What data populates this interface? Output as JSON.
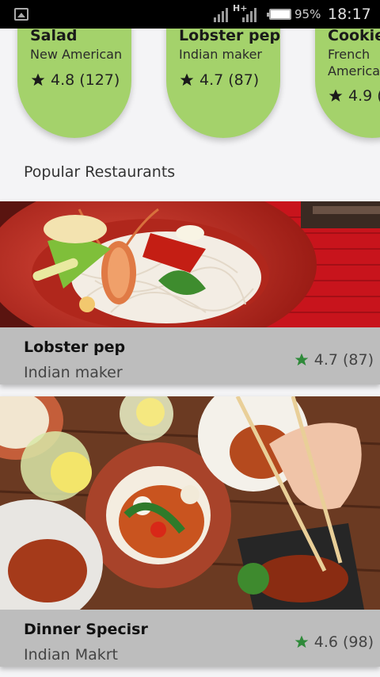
{
  "status_bar": {
    "network": "H+",
    "battery_percent": "95%",
    "time": "18:17"
  },
  "top_cards": [
    {
      "title": "Salad",
      "subtitle": "New American",
      "rating": "4.8",
      "count": "(127)"
    },
    {
      "title": "Lobster pep",
      "subtitle": "Indian maker",
      "rating": "4.7",
      "count": "(87)"
    },
    {
      "title": "Cookie",
      "subtitle_line1": "French",
      "subtitle_line2": "American",
      "rating": "4.9",
      "count": "("
    }
  ],
  "section_title": "Popular Restaurants",
  "restaurants": [
    {
      "name": "Lobster pep",
      "maker": "Indian maker",
      "rating": "4.7",
      "count": "(87)"
    },
    {
      "name": "Dinner Specisr",
      "maker": "Indian Makrt",
      "rating": "4.6",
      "count": "(98)"
    }
  ],
  "colors": {
    "card_green": "#a4d26b",
    "star_green": "#2f8a3a",
    "info_gray": "#bdbdbd"
  },
  "icons": {
    "star_dark": "star-icon",
    "star_green": "star-icon"
  }
}
